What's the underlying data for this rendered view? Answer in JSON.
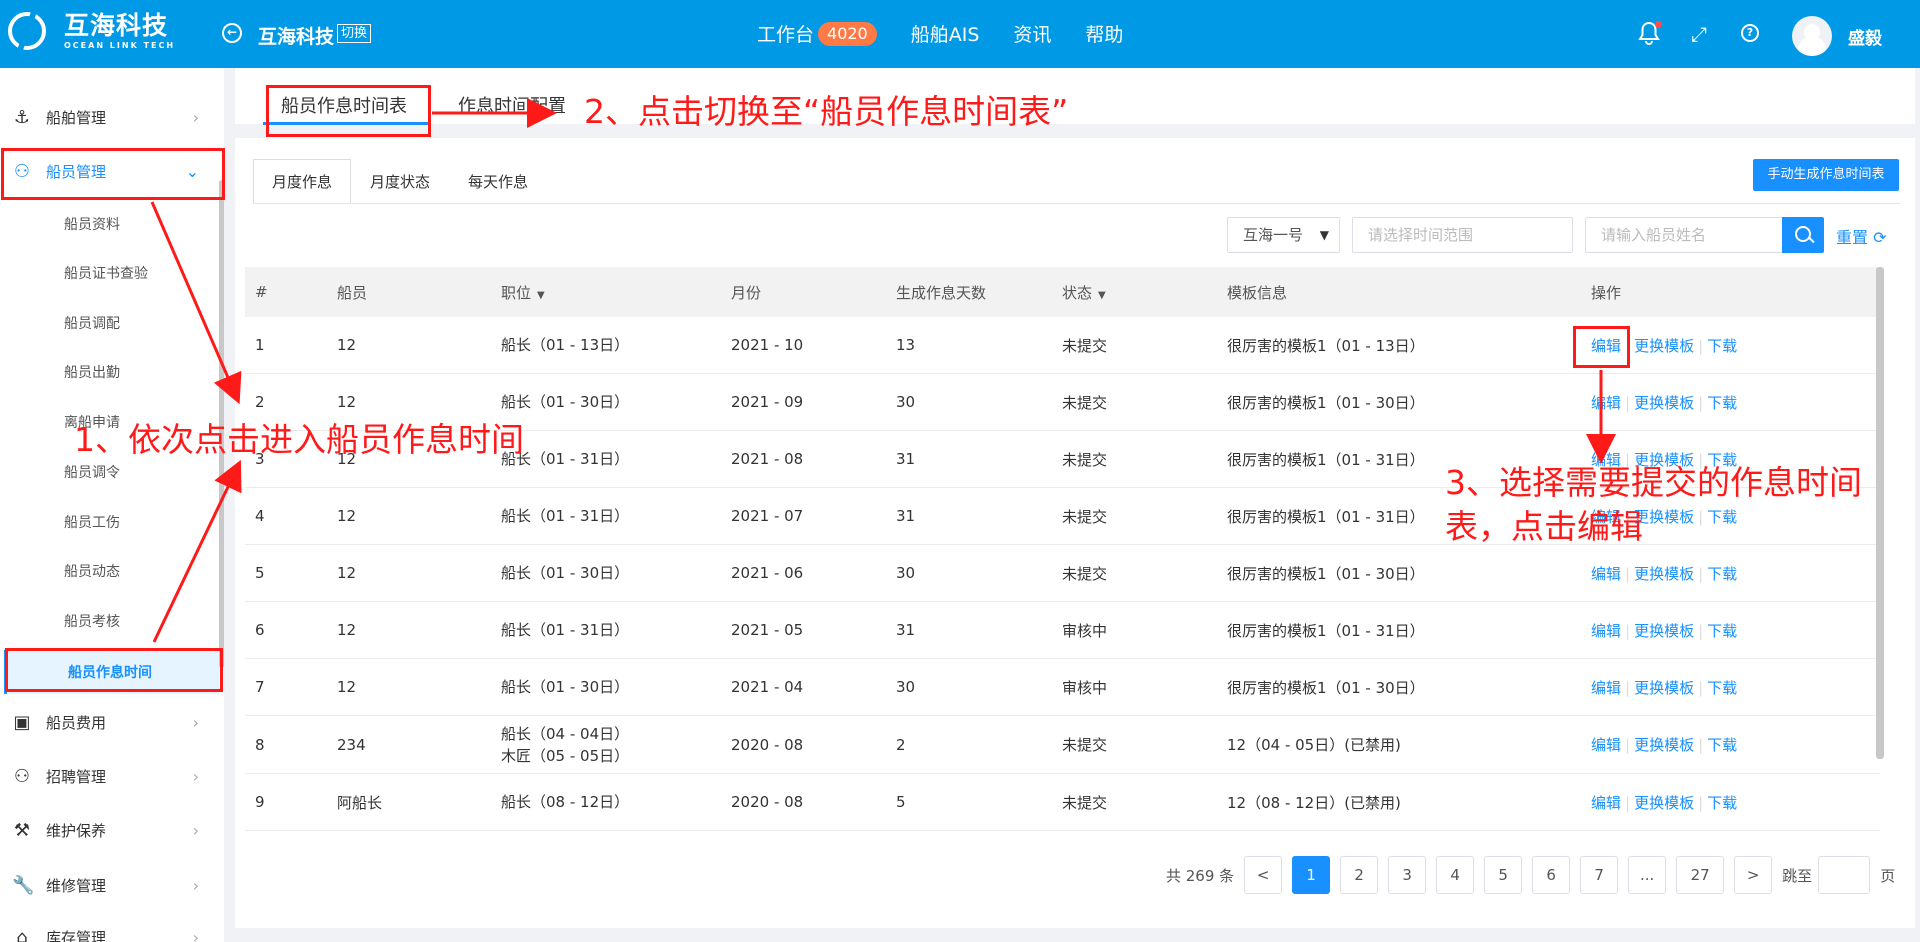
{
  "header": {
    "logo_cn": "互海科技",
    "logo_en": "OCEAN LINK TECH",
    "company": "互海科技",
    "switch": "切换",
    "nav": [
      {
        "label": "工作台",
        "badge": "4020"
      },
      {
        "label": "船舶AIS"
      },
      {
        "label": "资讯"
      },
      {
        "label": "帮助"
      }
    ],
    "username": "盛毅"
  },
  "sidebar": {
    "items": [
      {
        "label": "船舶管理",
        "icon": "anchor-icon"
      },
      {
        "label": "船员管理",
        "icon": "user-icon",
        "expanded": true
      },
      {
        "label": "船员费用",
        "icon": "wallet-icon"
      },
      {
        "label": "招聘管理",
        "icon": "recruit-icon"
      },
      {
        "label": "维护保养",
        "icon": "tool-icon"
      },
      {
        "label": "维修管理",
        "icon": "wrench-icon"
      },
      {
        "label": "库存管理",
        "icon": "home-icon"
      }
    ],
    "sub_items": [
      "船员资料",
      "船员证书查验",
      "船员调配",
      "船员出勤",
      "离船申请",
      "船员调令",
      "船员工伤",
      "船员动态",
      "船员考核",
      "船员作息时间"
    ]
  },
  "page_tabs": [
    "船员作息时间表",
    "作息时间配置"
  ],
  "sub_tabs": [
    "月度作息",
    "月度状态",
    "每天作息"
  ],
  "toolbar": {
    "generate_button": "手动生成作息时间表",
    "ship_select": "互海一号",
    "date_placeholder": "请选择时间范围",
    "name_placeholder": "请输入船员姓名",
    "reset": "重置"
  },
  "table": {
    "columns": [
      "#",
      "船员",
      "职位",
      "月份",
      "生成作息天数",
      "状态",
      "模板信息",
      "操作"
    ],
    "ops": [
      "编辑",
      "更换模板",
      "下载"
    ],
    "rows": [
      {
        "no": "1",
        "crew": "12",
        "pos": [
          "船长（01 - 13日）"
        ],
        "month": "2021 - 10",
        "days": "13",
        "status": "未提交",
        "template": "很厉害的模板1（01 - 13日）"
      },
      {
        "no": "2",
        "crew": "12",
        "pos": [
          "船长（01 - 30日）"
        ],
        "month": "2021 - 09",
        "days": "30",
        "status": "未提交",
        "template": "很厉害的模板1（01 - 30日）"
      },
      {
        "no": "3",
        "crew": "12",
        "pos": [
          "船长（01 - 31日）"
        ],
        "month": "2021 - 08",
        "days": "31",
        "status": "未提交",
        "template": "很厉害的模板1（01 - 31日）"
      },
      {
        "no": "4",
        "crew": "12",
        "pos": [
          "船长（01 - 31日）"
        ],
        "month": "2021 - 07",
        "days": "31",
        "status": "未提交",
        "template": "很厉害的模板1（01 - 31日）"
      },
      {
        "no": "5",
        "crew": "12",
        "pos": [
          "船长（01 - 30日）"
        ],
        "month": "2021 - 06",
        "days": "30",
        "status": "未提交",
        "template": "很厉害的模板1（01 - 30日）"
      },
      {
        "no": "6",
        "crew": "12",
        "pos": [
          "船长（01 - 31日）"
        ],
        "month": "2021 - 05",
        "days": "31",
        "status": "审核中",
        "template": "很厉害的模板1（01 - 31日）"
      },
      {
        "no": "7",
        "crew": "12",
        "pos": [
          "船长（01 - 30日）"
        ],
        "month": "2021 - 04",
        "days": "30",
        "status": "审核中",
        "template": "很厉害的模板1（01 - 30日）"
      },
      {
        "no": "8",
        "crew": "234",
        "pos": [
          "船长（04 - 04日）",
          "木匠（05 - 05日）"
        ],
        "month": "2020 - 08",
        "days": "2",
        "status": "未提交",
        "template": "12（04 - 05日）(已禁用)"
      },
      {
        "no": "9",
        "crew": "阿船长",
        "pos": [
          "船长（08 - 12日）"
        ],
        "month": "2020 - 08",
        "days": "5",
        "status": "未提交",
        "template": "12（08 - 12日）(已禁用)"
      }
    ]
  },
  "pagination": {
    "total": "共 269 条",
    "prev": "<",
    "pages": [
      "1",
      "2",
      "3",
      "4",
      "5",
      "6",
      "7",
      "...",
      "27"
    ],
    "current": "1",
    "next": ">",
    "jump_label": "跳至",
    "page_unit": "页"
  },
  "annotations": {
    "step1": "1、依次点击进入船员作息时间",
    "step2": "2、点击切换至“船员作息时间表”",
    "step3_line1": "3、选择需要提交的作息时间",
    "step3_line2": "表，点击编辑"
  },
  "colors": {
    "header": "#0099e6",
    "primary": "#1890ff",
    "annotation": "#ff1a1a",
    "badge": "#ff7a45"
  }
}
